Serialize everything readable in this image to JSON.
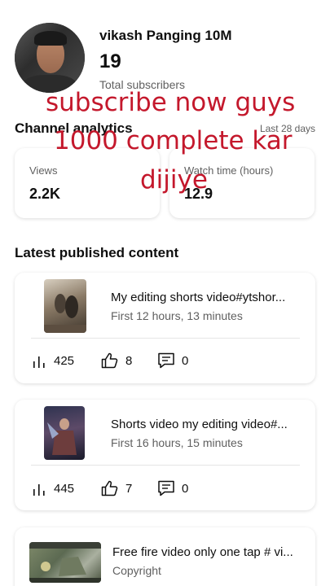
{
  "channel": {
    "name": "vikash Panging 10M",
    "subscriber_count": "19",
    "subscriber_label": "Total subscribers"
  },
  "analytics": {
    "title": "Channel analytics",
    "period": "Last 28 days",
    "views_label": "Views",
    "views_value": "2.2K",
    "watch_label": "Watch time (hours)",
    "watch_value": "12.9"
  },
  "overlay": {
    "line1": "subscribe now guys",
    "line2": "1000 complete kar",
    "line3": "dijiye"
  },
  "latest": {
    "title": "Latest published content",
    "items": [
      {
        "title": "My editing shorts video#ytshor...",
        "meta": "First 12 hours, 13 minutes",
        "views": "425",
        "likes": "8",
        "comments": "0"
      },
      {
        "title": "Shorts video my editing video#...",
        "meta": "First 16 hours, 15 minutes",
        "views": "445",
        "likes": "7",
        "comments": "0"
      },
      {
        "title": "Free fire video only one tap # vi...",
        "meta": "Copyright"
      }
    ]
  },
  "icons": {
    "views": "bar-chart-icon",
    "likes": "thumbs-up-icon",
    "comments": "comment-icon"
  },
  "colors": {
    "overlay_text": "#c4182c",
    "secondary_text": "#606060"
  }
}
